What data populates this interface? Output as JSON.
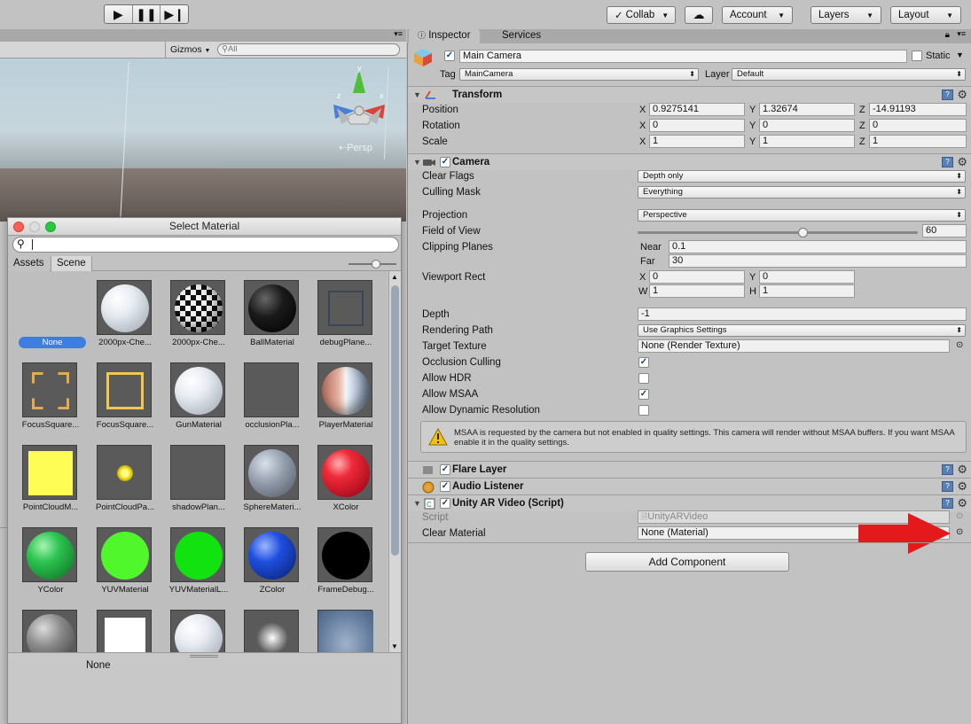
{
  "toolbar": {
    "play_icon": "play-icon",
    "pause_icon": "pause-icon",
    "step_icon": "step-icon",
    "collab": "Collab",
    "account": "Account",
    "layers": "Layers",
    "layout": "Layout"
  },
  "scene": {
    "gizmos": "Gizmos",
    "search_placeholder": "All",
    "persp": "Persp",
    "axis_y": "y",
    "axis_x": "x",
    "axis_z": "z"
  },
  "material_window": {
    "title": "Select Material",
    "tabs": [
      "Assets",
      "Scene"
    ],
    "items": [
      {
        "label": "None",
        "kind": "none"
      },
      {
        "label": "2000px-Che...",
        "kind": "white"
      },
      {
        "label": "2000px-Che...",
        "kind": "checker"
      },
      {
        "label": "BallMaterial",
        "kind": "black"
      },
      {
        "label": "debugPlane...",
        "kind": "debug"
      },
      {
        "label": "FocusSquare...",
        "kind": "focus1"
      },
      {
        "label": "FocusSquare...",
        "kind": "focus2"
      },
      {
        "label": "GunMaterial",
        "kind": "white"
      },
      {
        "label": "occlusionPla...",
        "kind": "empty"
      },
      {
        "label": "PlayerMaterial",
        "kind": "player"
      },
      {
        "label": "PointCloudM...",
        "kind": "yellowsq"
      },
      {
        "label": "PointCloudPa...",
        "kind": "glow"
      },
      {
        "label": "shadowPlan...",
        "kind": "empty"
      },
      {
        "label": "SphereMateri...",
        "kind": "grey"
      },
      {
        "label": "XColor",
        "kind": "red"
      },
      {
        "label": "YColor",
        "kind": "greenball"
      },
      {
        "label": "YUVMaterial",
        "kind": "limeflat"
      },
      {
        "label": "YUVMaterialL...",
        "kind": "greenflat"
      },
      {
        "label": "ZColor",
        "kind": "blue"
      },
      {
        "label": "FrameDebug...",
        "kind": "blackflat"
      },
      {
        "label": "",
        "kind": "darkball"
      },
      {
        "label": "",
        "kind": "whitesq"
      },
      {
        "label": "",
        "kind": "white"
      },
      {
        "label": "",
        "kind": "spot"
      },
      {
        "label": "",
        "kind": "bluish"
      }
    ],
    "selected": "None"
  },
  "inspector": {
    "tabs": [
      "Inspector",
      "Services"
    ],
    "object_name": "Main Camera",
    "static_label": "Static",
    "tag_label": "Tag",
    "tag_value": "MainCamera",
    "layer_label": "Layer",
    "layer_value": "Default",
    "transform": {
      "title": "Transform",
      "position_label": "Position",
      "rotation_label": "Rotation",
      "scale_label": "Scale",
      "position": [
        "0.9275141",
        "1.32674",
        "-14.91193"
      ],
      "rotation": [
        "0",
        "0",
        "0"
      ],
      "scale": [
        "1",
        "1",
        "1"
      ],
      "x": "X",
      "y": "Y",
      "z": "Z"
    },
    "camera": {
      "title": "Camera",
      "clear_flags_label": "Clear Flags",
      "clear_flags": "Depth only",
      "culling_mask_label": "Culling Mask",
      "culling_mask": "Everything",
      "projection_label": "Projection",
      "projection": "Perspective",
      "fov_label": "Field of View",
      "fov": "60",
      "fov_fraction": 0.59,
      "clipping_label": "Clipping Planes",
      "near_label": "Near",
      "near": "0.1",
      "far_label": "Far",
      "far": "30",
      "viewport_label": "Viewport Rect",
      "vp_x": "0",
      "vp_y": "0",
      "vp_w": "1",
      "vp_h": "1",
      "w": "W",
      "h": "H",
      "depth_label": "Depth",
      "depth": "-1",
      "rendering_path_label": "Rendering Path",
      "rendering_path": "Use Graphics Settings",
      "target_texture_label": "Target Texture",
      "target_texture": "None (Render Texture)",
      "occlusion_label": "Occlusion Culling",
      "hdr_label": "Allow HDR",
      "msaa_label": "Allow MSAA",
      "dynres_label": "Allow Dynamic Resolution",
      "warning": "MSAA is requested by the camera but not enabled in quality settings. This camera will render without MSAA buffers. If you want MSAA enable it in the quality settings."
    },
    "flare_layer": "Flare Layer",
    "audio_listener": "Audio Listener",
    "ar_video": {
      "title": "Unity AR Video (Script)",
      "script_label": "Script",
      "script_value": "UnityARVideo",
      "clear_material_label": "Clear Material",
      "clear_material_value": "None (Material)"
    },
    "add_component": "Add Component"
  },
  "colors": {
    "arrow": "#e3191b",
    "none_pill": "#3d7ee0",
    "check": "#1b3d7a"
  }
}
